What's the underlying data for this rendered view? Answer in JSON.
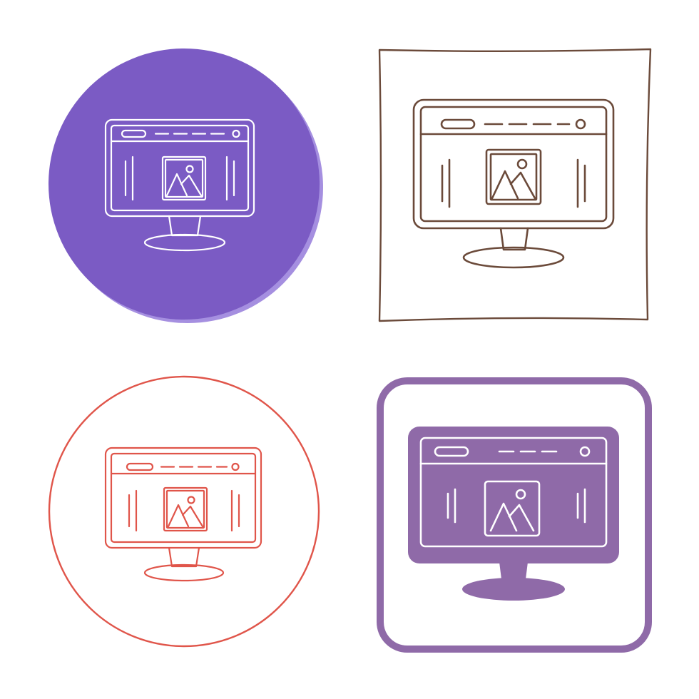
{
  "icon_set": {
    "icon": "monitor-with-web-page-icon",
    "variants": [
      {
        "id": "purple-circle",
        "style": "filled-circle-line-icon",
        "badge_color": "#7b5bc4",
        "badge_highlight": "#a58fe0",
        "line_color": "#ffffff"
      },
      {
        "id": "brown-square",
        "style": "sketch-square-line-icon",
        "line_color": "#6b4a3a"
      },
      {
        "id": "red-circle",
        "style": "outline-circle-line-icon",
        "line_color": "#e0554a"
      },
      {
        "id": "violet-square",
        "style": "outline-rounded-square-glyph-icon",
        "badge_color": "#8f6aa8",
        "line_color": "#ffffff"
      }
    ]
  }
}
